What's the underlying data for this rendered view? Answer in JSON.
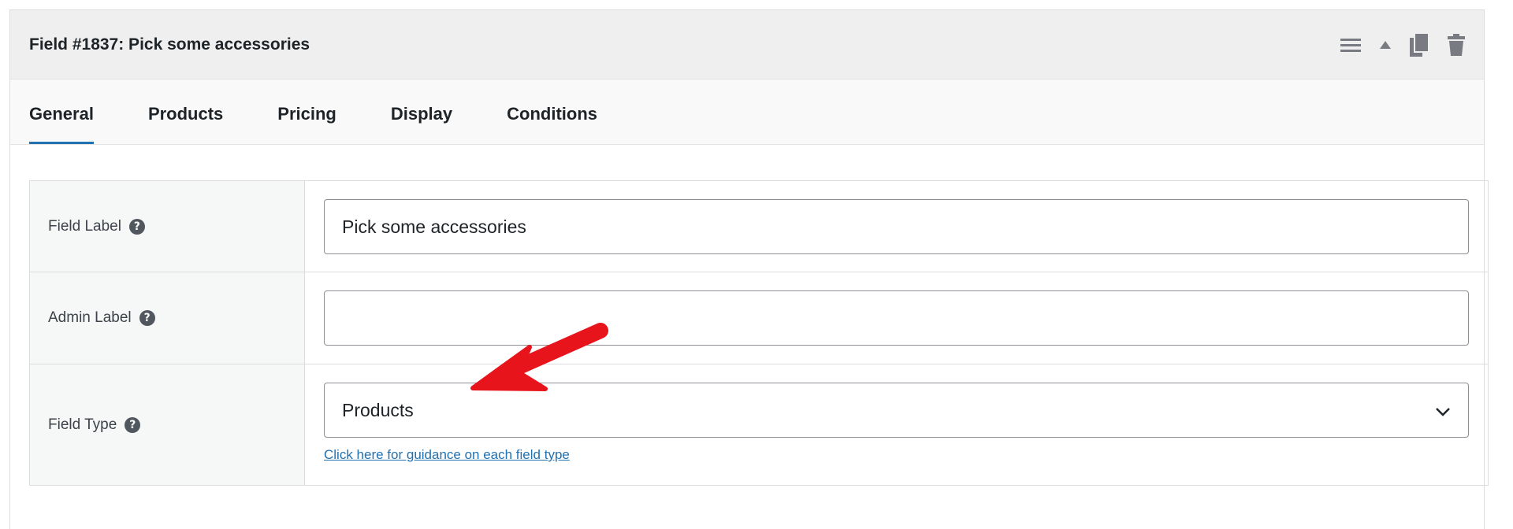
{
  "panel": {
    "title": "Field #1837: Pick some accessories",
    "actions": [
      "menu-icon",
      "collapse-triangle-icon",
      "duplicate-icon",
      "trash-icon"
    ]
  },
  "tabs": [
    {
      "label": "General",
      "active": true
    },
    {
      "label": "Products",
      "active": false
    },
    {
      "label": "Pricing",
      "active": false
    },
    {
      "label": "Display",
      "active": false
    },
    {
      "label": "Conditions",
      "active": false
    }
  ],
  "form": {
    "field_label": {
      "label": "Field Label",
      "value": "Pick some accessories"
    },
    "admin_label": {
      "label": "Admin Label",
      "value": ""
    },
    "field_type": {
      "label": "Field Type",
      "selected": "Products",
      "guidance_link": "Click here for guidance on each field type"
    },
    "help_glyph": "?"
  },
  "colors": {
    "accent": "#2271b1",
    "annotation_arrow": "#e8141b"
  }
}
